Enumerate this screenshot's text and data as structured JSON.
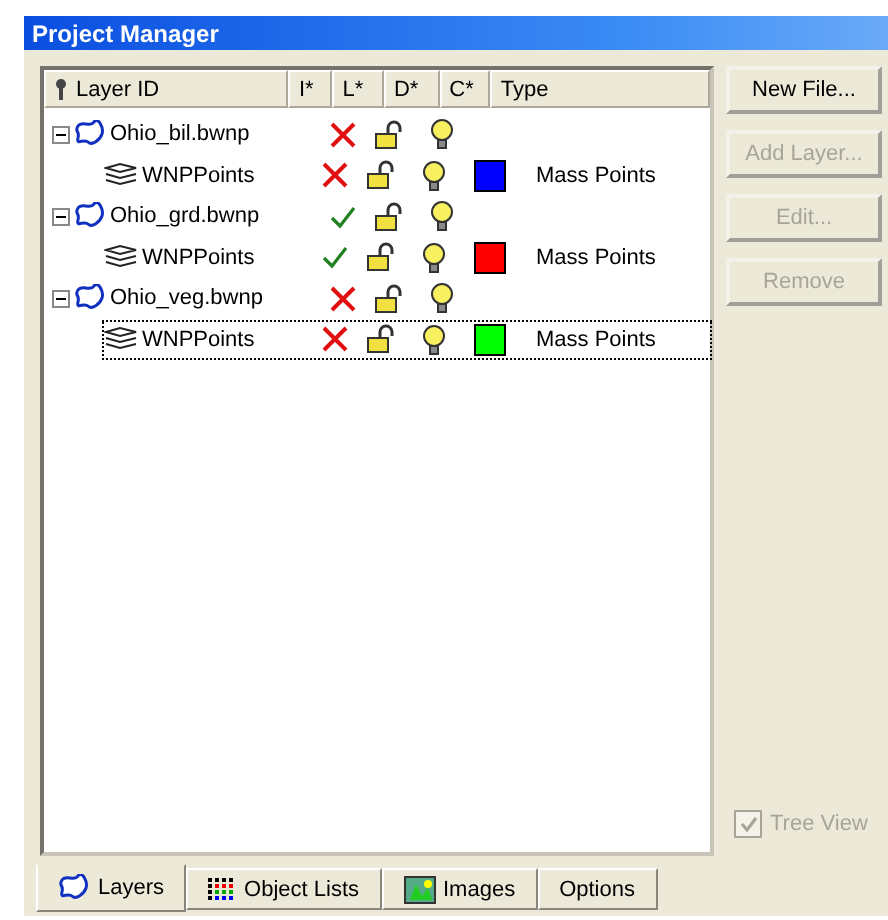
{
  "window": {
    "title": "Project Manager"
  },
  "columns": [
    "Layer ID",
    "I*",
    "L*",
    "D*",
    "C*",
    "Type"
  ],
  "layers": [
    {
      "name": "Ohio_bil.bwnp",
      "included": false,
      "expanded": true,
      "children": [
        {
          "name": "WNPPoints",
          "included": false,
          "color": "#0000ff",
          "type": "Mass Points",
          "selected": false
        }
      ]
    },
    {
      "name": "Ohio_grd.bwnp",
      "included": true,
      "expanded": true,
      "children": [
        {
          "name": "WNPPoints",
          "included": true,
          "color": "#ff0000",
          "type": "Mass Points",
          "selected": false
        }
      ]
    },
    {
      "name": "Ohio_veg.bwnp",
      "included": false,
      "expanded": true,
      "children": [
        {
          "name": "WNPPoints",
          "included": false,
          "color": "#00ff00",
          "type": "Mass Points",
          "selected": true
        }
      ]
    }
  ],
  "buttons": [
    {
      "label": "New File...",
      "disabled": false
    },
    {
      "label": "Add Layer...",
      "disabled": true
    },
    {
      "label": "Edit...",
      "disabled": true
    },
    {
      "label": "Remove",
      "disabled": true
    }
  ],
  "tree_view": {
    "label": "Tree View",
    "checked": true,
    "disabled": true
  },
  "tabs": [
    {
      "label": "Layers",
      "selected": true,
      "kind": "layers"
    },
    {
      "label": "Object Lists",
      "selected": false,
      "kind": "lists"
    },
    {
      "label": "Images",
      "selected": false,
      "kind": "images"
    },
    {
      "label": "Options",
      "selected": false,
      "kind": "options"
    }
  ]
}
